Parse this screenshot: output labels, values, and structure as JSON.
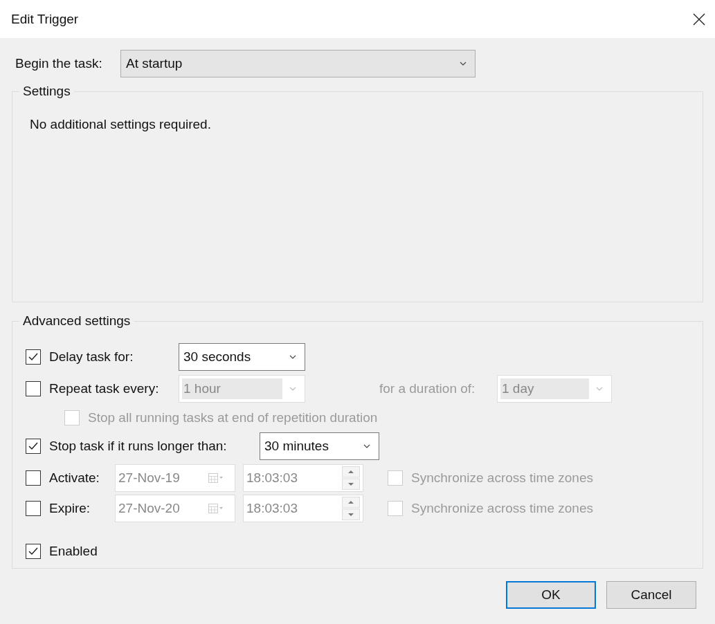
{
  "window": {
    "title": "Edit Trigger"
  },
  "begin": {
    "label": "Begin the task:",
    "value": "At startup"
  },
  "settings": {
    "title": "Settings",
    "message": "No additional settings required."
  },
  "advanced": {
    "title": "Advanced settings",
    "delay": {
      "label": "Delay task for:",
      "checked": true,
      "value": "30 seconds"
    },
    "repeat": {
      "label": "Repeat task every:",
      "checked": false,
      "value": "1 hour",
      "duration_label": "for a duration of:",
      "duration_value": "1 day"
    },
    "stop_all": {
      "label": "Stop all running tasks at end of repetition duration",
      "checked": false,
      "disabled": true
    },
    "stop_longer": {
      "label": "Stop task if it runs longer than:",
      "checked": true,
      "value": "30 minutes"
    },
    "schedule": [
      {
        "label": "Activate:",
        "checked": false,
        "date": "27-Nov-19",
        "time": "18:03:03",
        "sync_label": "Synchronize across time zones",
        "sync_checked": false
      },
      {
        "label": "Expire:",
        "checked": false,
        "date": "27-Nov-20",
        "time": "18:03:03",
        "sync_label": "Synchronize across time zones",
        "sync_checked": false
      }
    ],
    "enabled": {
      "label": "Enabled",
      "checked": true
    }
  },
  "buttons": [
    {
      "label": "OK",
      "default": true
    },
    {
      "label": "Cancel",
      "default": false
    }
  ]
}
